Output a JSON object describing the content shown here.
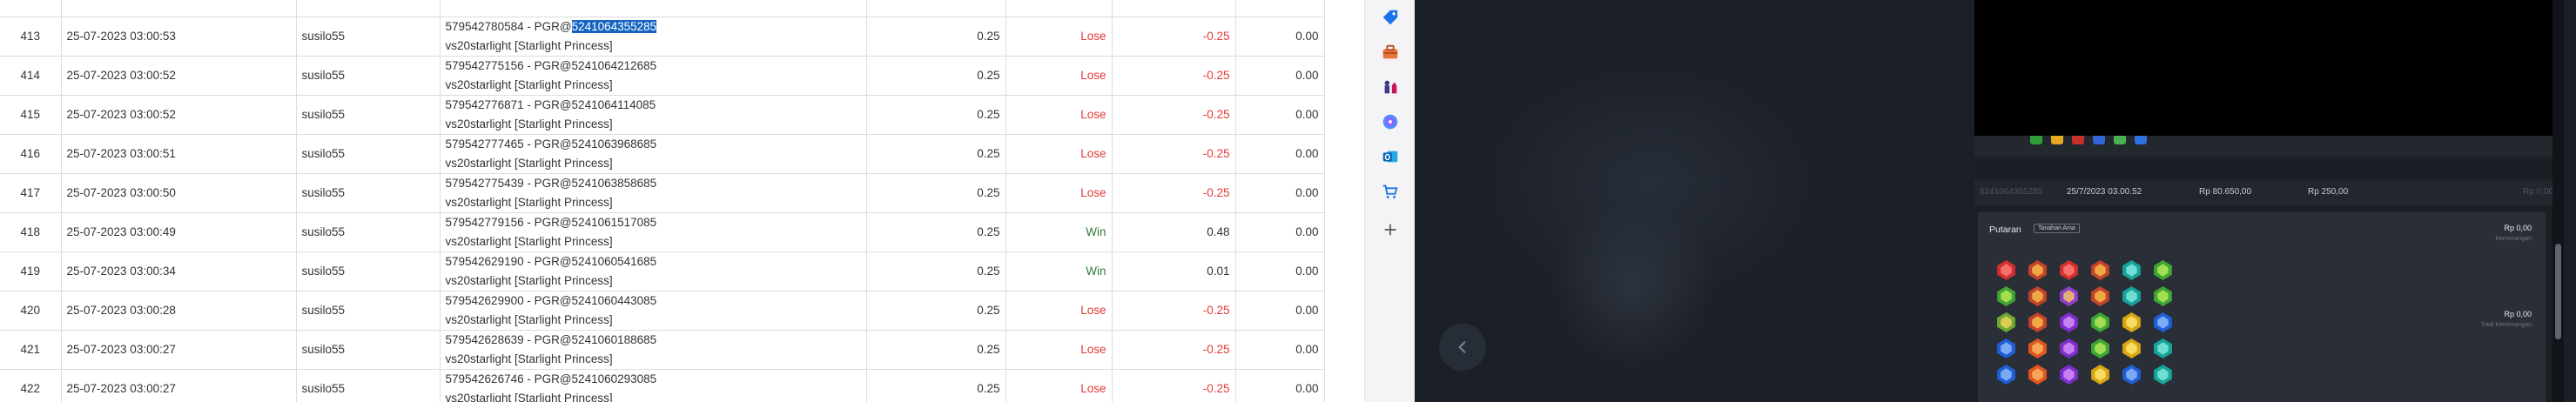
{
  "table": {
    "partial_top_row": {
      "no": "",
      "datetime": "",
      "user": "",
      "desc": "",
      "bet": "",
      "result": "",
      "winloss": "",
      "balance": ""
    },
    "rows": [
      {
        "no": "413",
        "datetime": "25-07-2023 03:00:53",
        "user": "susilo55",
        "desc_prefix": "579542780584 - PGR@",
        "desc_highlight": "5241064355285",
        "desc_line2": "vs20starlight [Starlight Princess]",
        "bet": "0.25",
        "result": "Lose",
        "winloss": "-0.25",
        "balance": "0.00"
      },
      {
        "no": "414",
        "datetime": "25-07-2023 03:00:52",
        "user": "susilo55",
        "desc_prefix": "579542775156 - PGR@5241064212685",
        "desc_highlight": "",
        "desc_line2": "vs20starlight [Starlight Princess]",
        "bet": "0.25",
        "result": "Lose",
        "winloss": "-0.25",
        "balance": "0.00"
      },
      {
        "no": "415",
        "datetime": "25-07-2023 03:00:52",
        "user": "susilo55",
        "desc_prefix": "579542776871 - PGR@5241064114085",
        "desc_highlight": "",
        "desc_line2": "vs20starlight [Starlight Princess]",
        "bet": "0.25",
        "result": "Lose",
        "winloss": "-0.25",
        "balance": "0.00"
      },
      {
        "no": "416",
        "datetime": "25-07-2023 03:00:51",
        "user": "susilo55",
        "desc_prefix": "579542777465 - PGR@5241063968685",
        "desc_highlight": "",
        "desc_line2": "vs20starlight [Starlight Princess]",
        "bet": "0.25",
        "result": "Lose",
        "winloss": "-0.25",
        "balance": "0.00"
      },
      {
        "no": "417",
        "datetime": "25-07-2023 03:00:50",
        "user": "susilo55",
        "desc_prefix": "579542775439 - PGR@5241063858685",
        "desc_highlight": "",
        "desc_line2": "vs20starlight [Starlight Princess]",
        "bet": "0.25",
        "result": "Lose",
        "winloss": "-0.25",
        "balance": "0.00"
      },
      {
        "no": "418",
        "datetime": "25-07-2023 03:00:49",
        "user": "susilo55",
        "desc_prefix": "579542779156 - PGR@5241061517085",
        "desc_highlight": "",
        "desc_line2": "vs20starlight [Starlight Princess]",
        "bet": "0.25",
        "result": "Win",
        "winloss": "0.48",
        "balance": "0.00"
      },
      {
        "no": "419",
        "datetime": "25-07-2023 03:00:34",
        "user": "susilo55",
        "desc_prefix": "579542629190 - PGR@5241060541685",
        "desc_highlight": "",
        "desc_line2": "vs20starlight [Starlight Princess]",
        "bet": "0.25",
        "result": "Win",
        "winloss": "0.01",
        "balance": "0.00"
      },
      {
        "no": "420",
        "datetime": "25-07-2023 03:00:28",
        "user": "susilo55",
        "desc_prefix": "579542629900 - PGR@5241060443085",
        "desc_highlight": "",
        "desc_line2": "vs20starlight [Starlight Princess]",
        "bet": "0.25",
        "result": "Lose",
        "winloss": "-0.25",
        "balance": "0.00"
      },
      {
        "no": "421",
        "datetime": "25-07-2023 03:00:27",
        "user": "susilo55",
        "desc_prefix": "579542628639 - PGR@5241060188685",
        "desc_highlight": "",
        "desc_line2": "vs20starlight [Starlight Princess]",
        "bet": "0.25",
        "result": "Lose",
        "winloss": "-0.25",
        "balance": "0.00"
      },
      {
        "no": "422",
        "datetime": "25-07-2023 03:00:27",
        "user": "susilo55",
        "desc_prefix": "579542626746 - PGR@5241060293085",
        "desc_highlight": "",
        "desc_line2": "vs20starlight [Starlight Princess]",
        "bet": "0.25",
        "result": "Lose",
        "winloss": "-0.25",
        "balance": "0.00"
      }
    ]
  },
  "colors": {
    "lose": "#e53935",
    "win": "#2e7d32",
    "highlight": "#1565c0",
    "dark_bg": "#1b1f26"
  },
  "sidebar": {
    "icons": [
      "tag-icon",
      "toolbox-icon",
      "chess-icon",
      "copilot-icon",
      "outlook-icon",
      "shopping-cart-icon",
      "plus-icon"
    ]
  },
  "game_history": {
    "detail": {
      "round_id": "5241064355285",
      "datetime": "25/7/2023 03.00.52",
      "balance_before": "Rp 80.650,00",
      "balance_after": "Rp 250,00",
      "win": "Rp 0,00"
    },
    "spin": {
      "title": "Putaran",
      "tag": "Tanahan Ama",
      "win_label_1": "Rp 0,00",
      "win_sub_1": "Kemenangan",
      "win_label_2": "Rp 0,00",
      "win_sub_2": "Total Kemenangan"
    },
    "grid_symbols": [
      [
        "red-gem",
        "crown",
        "red-gem",
        "crown",
        "teal-gem",
        "green-gem"
      ],
      [
        "green-gem",
        "crown",
        "chalice",
        "crown",
        "teal-gem",
        "green-gem"
      ],
      [
        "ring",
        "crown",
        "purple-gem",
        "green-gem",
        "yellow-gem",
        "blue-gem"
      ],
      [
        "blue-gem",
        "orange-gem",
        "purple-gem",
        "green-gem",
        "yellow-gem",
        "teal-gem"
      ],
      [
        "blue-gem",
        "orange-gem",
        "purple-gem",
        "yellow-gem",
        "blue-gem",
        "teal-gem"
      ]
    ]
  }
}
